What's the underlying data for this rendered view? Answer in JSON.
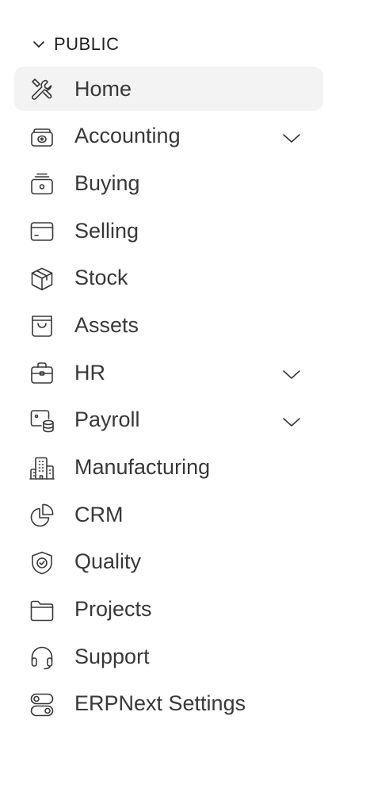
{
  "section": {
    "label": "PUBLIC",
    "icon": "chevron-down-icon"
  },
  "nav": {
    "items": [
      {
        "label": "Home",
        "icon": "tools-icon",
        "active": true,
        "expandable": false
      },
      {
        "label": "Accounting",
        "icon": "money-icon",
        "active": false,
        "expandable": true
      },
      {
        "label": "Buying",
        "icon": "coin-stack-icon",
        "active": false,
        "expandable": false
      },
      {
        "label": "Selling",
        "icon": "card-icon",
        "active": false,
        "expandable": false
      },
      {
        "label": "Stock",
        "icon": "box-icon",
        "active": false,
        "expandable": false
      },
      {
        "label": "Assets",
        "icon": "bag-icon",
        "active": false,
        "expandable": false
      },
      {
        "label": "HR",
        "icon": "briefcase-icon",
        "active": false,
        "expandable": true
      },
      {
        "label": "Payroll",
        "icon": "payroll-icon",
        "active": false,
        "expandable": true
      },
      {
        "label": "Manufacturing",
        "icon": "building-icon",
        "active": false,
        "expandable": false
      },
      {
        "label": "CRM",
        "icon": "pie-chart-icon",
        "active": false,
        "expandable": false
      },
      {
        "label": "Quality",
        "icon": "shield-check-icon",
        "active": false,
        "expandable": false
      },
      {
        "label": "Projects",
        "icon": "folder-icon",
        "active": false,
        "expandable": false
      },
      {
        "label": "Support",
        "icon": "headset-icon",
        "active": false,
        "expandable": false
      },
      {
        "label": "ERPNext Settings",
        "icon": "toggles-icon",
        "active": false,
        "expandable": false
      }
    ]
  }
}
